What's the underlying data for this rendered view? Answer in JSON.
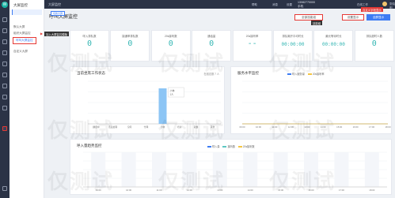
{
  "app": {
    "logo": "W"
  },
  "sidebar": {
    "title": "大屏监控",
    "items": [
      {
        "label": "默认大屏"
      },
      {
        "label": "组织大屏监控"
      },
      {
        "label": "呼叫大屏监控"
      },
      {
        "label": "自定义大屏"
      }
    ],
    "tooltip_add": "加入大屏监控模板"
  },
  "topbar": {
    "tab": "大屏监控",
    "buttons": [
      "帮助",
      "消息",
      "设置"
    ],
    "phone": "13082770000",
    "phone_sub": "手机",
    "user": "张晓明",
    "online": "在线工作",
    "tooltip_custom": "自定义字段显示"
  },
  "header": {
    "title": "呼叫大屏监控",
    "tag": "切换大屏",
    "btn_range": "全部技能组",
    "btn_settings": "设置显示",
    "btn_fullscreen": "全屏显示",
    "tooltip_skill": "技能组"
  },
  "stats": [
    {
      "label": "呼入排队数",
      "value": "0"
    },
    {
      "label": "接通率排队数",
      "value": "0"
    },
    {
      "label": "20s接听数",
      "value": "0"
    },
    {
      "label": "通话量",
      "value": "0"
    },
    {
      "label": "20s接听率",
      "value": "--"
    },
    {
      "label": "排队离开平均时长",
      "value": "00:00:00"
    },
    {
      "label": "最长等待时长",
      "value": "00:00:00"
    },
    {
      "label": "排队超时人数",
      "value": "0"
    }
  ],
  "agent_panel": {
    "title": "当前坐席工作状态",
    "note": "在线总数 7 人",
    "bar_tooltip": "小休\n1人"
  },
  "service_panel": {
    "title": "服务水平监控",
    "legend": [
      "呼入服务量",
      "20s接听率"
    ]
  },
  "queue_panel": {
    "title": "呼入量趋势监控",
    "legend": [
      "呼入量",
      "接听数",
      "20s接听数"
    ]
  },
  "watermark": "仅测试",
  "chart_data": [
    {
      "type": "bar",
      "title": "当前坐席工作状态",
      "categories": [
        "通话中",
        "话后处理",
        "空闲",
        "忙碌",
        "小休",
        "培训",
        "就餐",
        "其他"
      ],
      "values": [
        0,
        0,
        0,
        0,
        1,
        0,
        0,
        0
      ],
      "ylim": [
        0,
        1.2
      ],
      "legend": "none"
    },
    {
      "type": "line",
      "title": "服务水平监控",
      "series": [
        {
          "name": "呼入服务量",
          "values": [
            0,
            0,
            0,
            0,
            0,
            0,
            0,
            0,
            0,
            0
          ]
        },
        {
          "name": "20s接听率",
          "values": [
            0,
            0,
            0,
            0,
            0,
            0,
            0,
            0,
            0,
            0
          ]
        }
      ],
      "x": [
        "09:00",
        "10:00",
        "11:00",
        "12:00",
        "13:00",
        "14:00",
        "15:00",
        "16:00",
        "17:00",
        "18:00"
      ],
      "legend": "top"
    },
    {
      "type": "bar",
      "title": "呼入量趋势监控",
      "series": [
        {
          "name": "呼入量",
          "values": [
            0,
            0,
            0,
            0,
            0,
            0,
            0,
            0,
            0,
            0
          ]
        },
        {
          "name": "接听数",
          "values": [
            0,
            0,
            0,
            0,
            0,
            0,
            0,
            0,
            0,
            0
          ]
        },
        {
          "name": "20s接听数",
          "values": [
            0,
            0,
            0,
            0,
            0,
            0,
            0,
            0,
            0,
            0
          ]
        }
      ],
      "x": [
        "09:00",
        "10:00",
        "11:00",
        "12:00",
        "13:00",
        "14:00",
        "15:00",
        "16:00",
        "17:00",
        "18:00"
      ],
      "legend": "top"
    }
  ]
}
